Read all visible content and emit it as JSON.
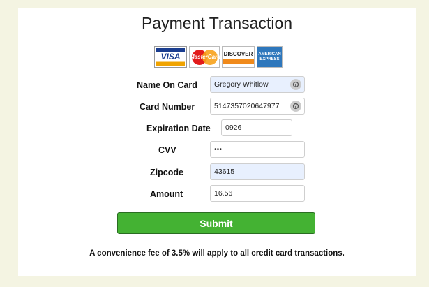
{
  "page": {
    "title": "Payment Transaction"
  },
  "card_logos": [
    {
      "name": "visa",
      "text": "VISA"
    },
    {
      "name": "mastercard",
      "text": "MasterCard"
    },
    {
      "name": "discover",
      "text": "DISCOVER"
    },
    {
      "name": "amex",
      "text": "AMERICAN EXPRESS"
    }
  ],
  "form": {
    "name_on_card": {
      "label": "Name On Card",
      "value": "Gregory Whitlow"
    },
    "card_number": {
      "label": "Card Number",
      "value": "5147357020647977"
    },
    "expiration_date": {
      "label": "Expiration Date",
      "value": "0926"
    },
    "cvv": {
      "label": "CVV",
      "value": "•••"
    },
    "zipcode": {
      "label": "Zipcode",
      "value": "43615"
    },
    "amount": {
      "label": "Amount",
      "value": "16.56"
    }
  },
  "submit": {
    "label": "Submit"
  },
  "note": "A convenience fee of 3.5% will apply to all credit card transactions.",
  "colors": {
    "background": "#f4f4e2",
    "submit": "#44b233",
    "autofill": "#e8f0fe"
  }
}
